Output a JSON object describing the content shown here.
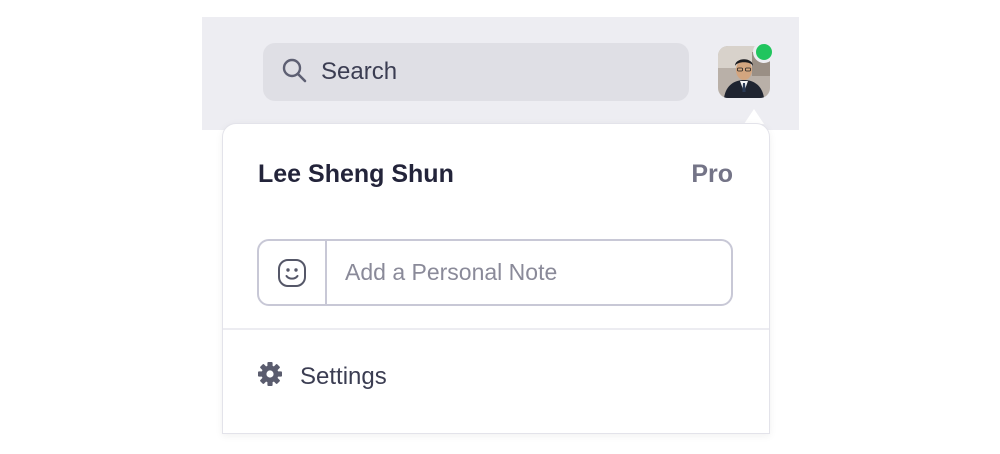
{
  "header": {
    "search_label": "Search",
    "search_icon": "search-icon",
    "avatar_status_color": "#21c55e"
  },
  "profile_menu": {
    "user_name": "Lee Sheng Shun",
    "plan": "Pro",
    "note_placeholder": "Add a Personal Note",
    "note_icon": "smiley-icon",
    "settings_label": "Settings",
    "settings_icon": "gear-icon"
  }
}
